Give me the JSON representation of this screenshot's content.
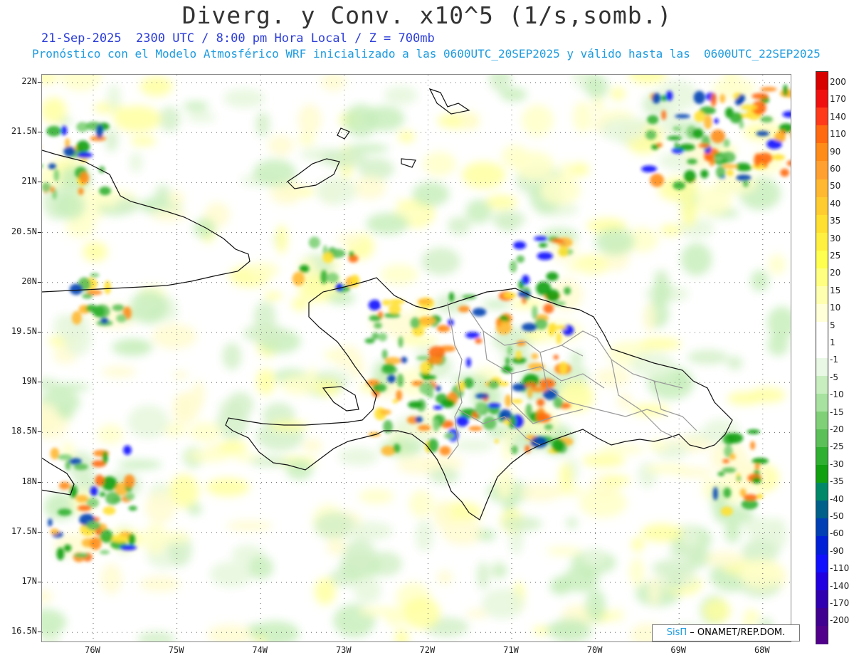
{
  "title": "Diverg. y Conv. x10^5 (1/s,somb.)",
  "subtitle_date": "21-Sep-2025  2300 UTC / 8:00 pm Hora Local / Z = 700mb",
  "subtitle_model": "Pronóstico con el Modelo Atmosférico WRF inicializado a las 0600UTC_20SEP2025 y válido hasta las  0600UTC_22SEP2025",
  "latitude_labels": [
    "22N",
    "21.5N",
    "21N",
    "20.5N",
    "20N",
    "19.5N",
    "19N",
    "18.5N",
    "18N",
    "17.5N",
    "17N",
    "16.5N"
  ],
  "longitude_labels": [
    "76W",
    "75W",
    "74W",
    "73W",
    "72W",
    "71W",
    "70W",
    "69W",
    "68W"
  ],
  "colorbar": {
    "labels": [
      "200",
      "170",
      "140",
      "110",
      "90",
      "60",
      "50",
      "40",
      "35",
      "30",
      "25",
      "20",
      "15",
      "10",
      "5",
      "1",
      "-1",
      "-5",
      "-10",
      "-15",
      "-20",
      "-25",
      "-30",
      "-35",
      "-40",
      "-50",
      "-60",
      "-90",
      "-110",
      "-140",
      "-170",
      "-200"
    ],
    "colors": [
      "#d90000",
      "#f01010",
      "#ff3a1a",
      "#ff6a10",
      "#ff8c18",
      "#ffa030",
      "#ffb830",
      "#ffcc30",
      "#ffe030",
      "#fff040",
      "#ffff50",
      "#ffff80",
      "#ffffb0",
      "#ffffd8",
      "#ffffff",
      "#ffffff",
      "#e8f8e4",
      "#c8eec0",
      "#a8e2a0",
      "#80d078",
      "#5cc058",
      "#30b030",
      "#10a010",
      "#008868",
      "#00608a",
      "#0040b4",
      "#0020d8",
      "#1010ff",
      "#2000e0",
      "#3000b0",
      "#400090",
      "#50008a"
    ]
  },
  "credit": {
    "logo": "SisΠ",
    "text": " – ONAMET/REP.DOM."
  }
}
